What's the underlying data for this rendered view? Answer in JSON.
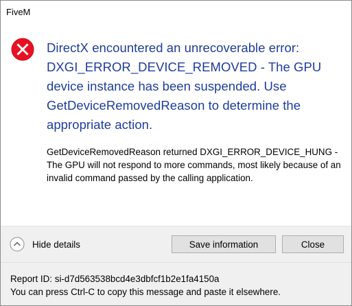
{
  "window": {
    "title": "FiveM"
  },
  "message": {
    "icon": "error-icon",
    "main_instruction": "DirectX encountered an unrecoverable error: DXGI_ERROR_DEVICE_REMOVED - The GPU device instance has been suspended. Use GetDeviceRemovedReason to determine the appropriate action.",
    "content": "GetDeviceRemovedReason returned DXGI_ERROR_DEVICE_HUNG - The GPU will not respond to more commands, most likely because of an invalid command passed by the calling application."
  },
  "footer": {
    "details_toggle_label": "Hide details",
    "details_toggle_icon": "chevron-up-icon",
    "save_button_label": "Save information",
    "close_button_label": "Close",
    "report_id": "Report ID: si-d7d563538bcd4e3dbfcf1b2e1fa4150a",
    "copy_hint": "You can press Ctrl-C to copy this message and paste it elsewhere."
  },
  "colors": {
    "instruction_text": "#1f3c9c",
    "error_icon_fill": "#e81123",
    "footer_background": "#f0f0f0",
    "button_background": "#e1e1e1"
  }
}
